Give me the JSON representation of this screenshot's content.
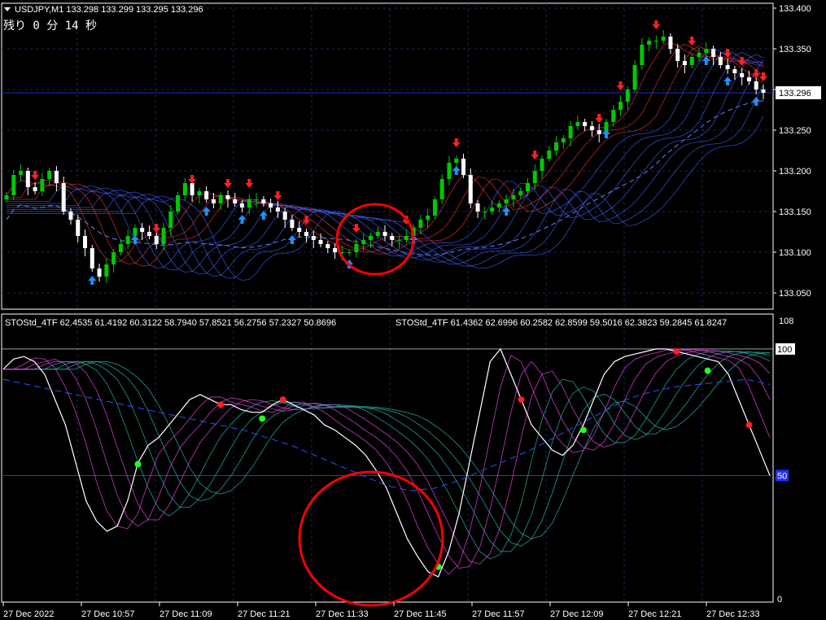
{
  "header": {
    "symbol_line": "USDJPY,M1  133.298 133.299 133.295 133.296",
    "countdown": "残り 0 分 14 秒"
  },
  "indicator_header": {
    "line1": "STOStd_4TF 62.4535 61.4192 60.3122 58.7940 57.8521 56.2756 57.2327 50.8696",
    "line2": "STOStd_4TF 61.4362 62.6996 60.2582 62.8599 59.5016 62.3823 59.2845 61.8247"
  },
  "price_axis": {
    "labels": [
      "133.400",
      "133.350",
      "133.300",
      "133.250",
      "133.200",
      "133.150",
      "133.100",
      "133.050"
    ],
    "current_price": "133.296"
  },
  "indicator_axis": {
    "top_label": "108",
    "upper_label": "100",
    "mid_label": "50",
    "bottom_label": "0"
  },
  "time_axis": {
    "labels": [
      "27 Dec 2022",
      "27 Dec 10:57",
      "27 Dec 11:09",
      "27 Dec 11:21",
      "27 Dec 11:33",
      "27 Dec 11:45",
      "27 Dec 11:57",
      "27 Dec 12:09",
      "27 Dec 12:21",
      "27 Dec 12:33"
    ]
  },
  "colors": {
    "background": "#000000",
    "grid": "#1e2a5a",
    "bull": "#00c800",
    "bear": "#ffffff",
    "up_arrow": "#1e90ff",
    "down_arrow": "#ff2020",
    "ribbon_warm": "#ff3030",
    "ribbon_cool": "#4060ff",
    "sto_main": "#ffffff",
    "sto_magenta": "#e040e0",
    "sto_teal": "#20b0a0",
    "dot_red": "#ff2020",
    "dot_green": "#20ff20",
    "annotation_circle": "#ff0000"
  },
  "chart_data": [
    {
      "type": "candlestick",
      "title": "USDJPY,M1",
      "ylim": [
        133.03,
        133.4
      ],
      "x_start": "27 Dec 10:46",
      "x_step_minutes": 1,
      "close_series": [
        133.17,
        133.195,
        133.2,
        133.18,
        133.175,
        133.19,
        133.2,
        133.185,
        133.15,
        133.14,
        133.12,
        133.105,
        133.08,
        133.07,
        133.085,
        133.1,
        133.11,
        133.12,
        133.13,
        133.125,
        133.12,
        133.11,
        133.13,
        133.15,
        133.17,
        133.185,
        133.17,
        133.175,
        133.165,
        133.16,
        133.17,
        133.165,
        133.16,
        133.155,
        133.165,
        133.165,
        133.16,
        133.155,
        133.15,
        133.14,
        133.13,
        133.125,
        133.12,
        133.115,
        133.11,
        133.105,
        133.1,
        133.1,
        133.1,
        133.11,
        133.115,
        133.12,
        133.125,
        133.12,
        133.115,
        133.115,
        133.12,
        133.13,
        133.14,
        133.145,
        133.165,
        133.19,
        133.21,
        133.215,
        133.195,
        133.16,
        133.15,
        133.15,
        133.155,
        133.16,
        133.165,
        133.17,
        133.175,
        133.185,
        133.2,
        133.215,
        133.225,
        133.235,
        133.24,
        133.255,
        133.26,
        133.255,
        133.25,
        133.245,
        133.26,
        133.275,
        133.285,
        133.3,
        133.33,
        133.355,
        133.36,
        133.36,
        133.365,
        133.35,
        133.335,
        133.33,
        133.34,
        133.345,
        133.35,
        133.34,
        133.33,
        133.325,
        133.32,
        133.315,
        133.31,
        133.3,
        133.296
      ],
      "bull_signals_count": 16,
      "bear_signals_count": 20
    },
    {
      "type": "line",
      "title": "STOStd_4TF",
      "ylim": [
        0,
        108
      ],
      "reference_levels": [
        50,
        100
      ],
      "main_series": [
        92,
        96,
        97,
        95,
        90,
        80,
        70,
        55,
        40,
        32,
        28,
        30,
        40,
        55,
        62,
        65,
        70,
        75,
        80,
        82,
        80,
        78,
        78,
        76,
        75,
        75,
        78,
        80,
        78,
        76,
        74,
        70,
        68,
        65,
        62,
        58,
        52,
        45,
        35,
        25,
        18,
        12,
        10,
        20,
        35,
        55,
        75,
        95,
        100,
        90,
        80,
        70,
        65,
        60,
        58,
        62,
        70,
        80,
        90,
        95,
        97,
        98,
        99,
        100,
        100,
        99,
        98,
        97,
        96,
        95,
        90,
        80,
        70,
        60,
        50
      ],
      "slow_series_dashed": [
        88,
        86,
        84,
        82,
        80,
        78,
        76,
        74,
        72,
        70,
        68,
        65,
        62,
        58,
        54,
        50,
        46,
        44,
        45,
        48,
        52,
        56,
        60,
        65,
        70,
        75,
        80,
        83,
        85,
        86,
        87,
        88,
        86
      ],
      "green_dots_count": 6,
      "red_dots_count": 5
    }
  ]
}
